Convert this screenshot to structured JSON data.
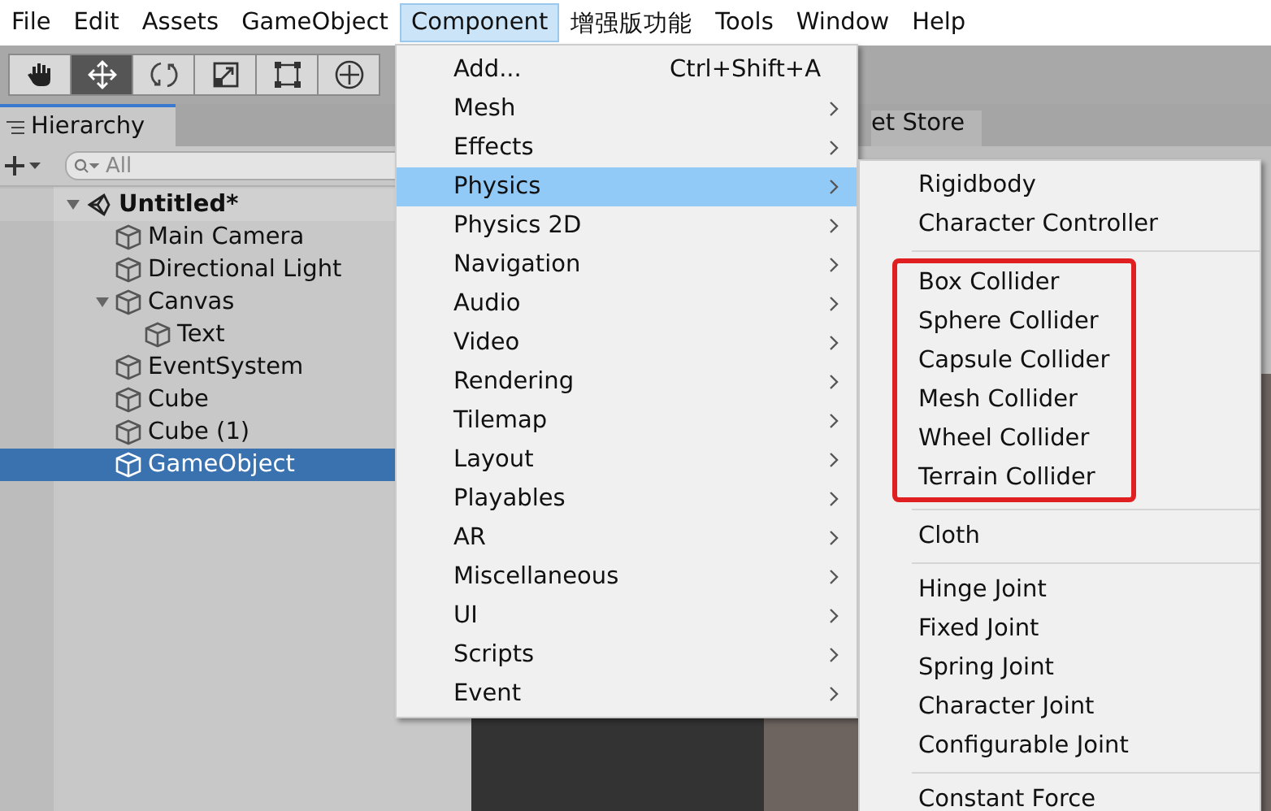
{
  "menu_bar": [
    {
      "label": "File",
      "selected": false
    },
    {
      "label": "Edit",
      "selected": false
    },
    {
      "label": "Assets",
      "selected": false
    },
    {
      "label": "GameObject",
      "selected": false
    },
    {
      "label": "Component",
      "selected": true
    },
    {
      "label": "增强版功能",
      "selected": false
    },
    {
      "label": "Tools",
      "selected": false
    },
    {
      "label": "Window",
      "selected": false
    },
    {
      "label": "Help",
      "selected": false
    }
  ],
  "toolbar": {
    "tools": [
      {
        "kind": "hand",
        "selected": false
      },
      {
        "kind": "move",
        "selected": true
      },
      {
        "kind": "rotate",
        "selected": false
      },
      {
        "kind": "scale",
        "selected": false
      },
      {
        "kind": "rect",
        "selected": false
      },
      {
        "kind": "transform",
        "selected": false
      }
    ]
  },
  "hierarchy": {
    "tab": "Hierarchy",
    "search": {
      "placeholder": "All"
    },
    "tree": [
      {
        "label": "Untitled*",
        "kind": "scene",
        "expanded": true,
        "selected": false,
        "children": [
          {
            "label": "Main Camera",
            "kind": "object",
            "selected": false
          },
          {
            "label": "Directional Light",
            "kind": "object",
            "selected": false
          },
          {
            "label": "Canvas",
            "kind": "object",
            "expanded": true,
            "selected": false,
            "children": [
              {
                "label": "Text",
                "kind": "object",
                "selected": false
              }
            ]
          },
          {
            "label": "EventSystem",
            "kind": "object",
            "selected": false
          },
          {
            "label": "Cube",
            "kind": "object",
            "selected": false
          },
          {
            "label": "Cube (1)",
            "kind": "object",
            "selected": false
          },
          {
            "label": "GameObject",
            "kind": "object",
            "selected": true
          }
        ]
      }
    ]
  },
  "background_tab": {
    "label": "et Store"
  },
  "component_menu": {
    "items": [
      {
        "label": "Add...",
        "shortcut": "Ctrl+Shift+A",
        "submenu": false,
        "selected": false
      },
      {
        "label": "Mesh",
        "submenu": true,
        "selected": false
      },
      {
        "label": "Effects",
        "submenu": true,
        "selected": false
      },
      {
        "label": "Physics",
        "submenu": true,
        "selected": true
      },
      {
        "label": "Physics 2D",
        "submenu": true,
        "selected": false
      },
      {
        "label": "Navigation",
        "submenu": true,
        "selected": false
      },
      {
        "label": "Audio",
        "submenu": true,
        "selected": false
      },
      {
        "label": "Video",
        "submenu": true,
        "selected": false
      },
      {
        "label": "Rendering",
        "submenu": true,
        "selected": false
      },
      {
        "label": "Tilemap",
        "submenu": true,
        "selected": false
      },
      {
        "label": "Layout",
        "submenu": true,
        "selected": false
      },
      {
        "label": "Playables",
        "submenu": true,
        "selected": false
      },
      {
        "label": "AR",
        "submenu": true,
        "selected": false
      },
      {
        "label": "Miscellaneous",
        "submenu": true,
        "selected": false
      },
      {
        "label": "UI",
        "submenu": true,
        "selected": false
      },
      {
        "label": "Scripts",
        "submenu": true,
        "selected": false
      },
      {
        "label": "Event",
        "submenu": true,
        "selected": false
      }
    ]
  },
  "physics_submenu": {
    "groups": [
      {
        "highlighted": false,
        "items": [
          "Rigidbody",
          "Character Controller"
        ]
      },
      {
        "highlighted": true,
        "items": [
          "Box Collider",
          "Sphere Collider",
          "Capsule Collider",
          "Mesh Collider",
          "Wheel Collider",
          "Terrain Collider"
        ]
      },
      {
        "highlighted": false,
        "items": [
          "Cloth"
        ]
      },
      {
        "highlighted": false,
        "items": [
          "Hinge Joint",
          "Fixed Joint",
          "Spring Joint",
          "Character Joint",
          "Configurable Joint"
        ]
      },
      {
        "highlighted": false,
        "items": [
          "Constant Force"
        ]
      }
    ]
  }
}
